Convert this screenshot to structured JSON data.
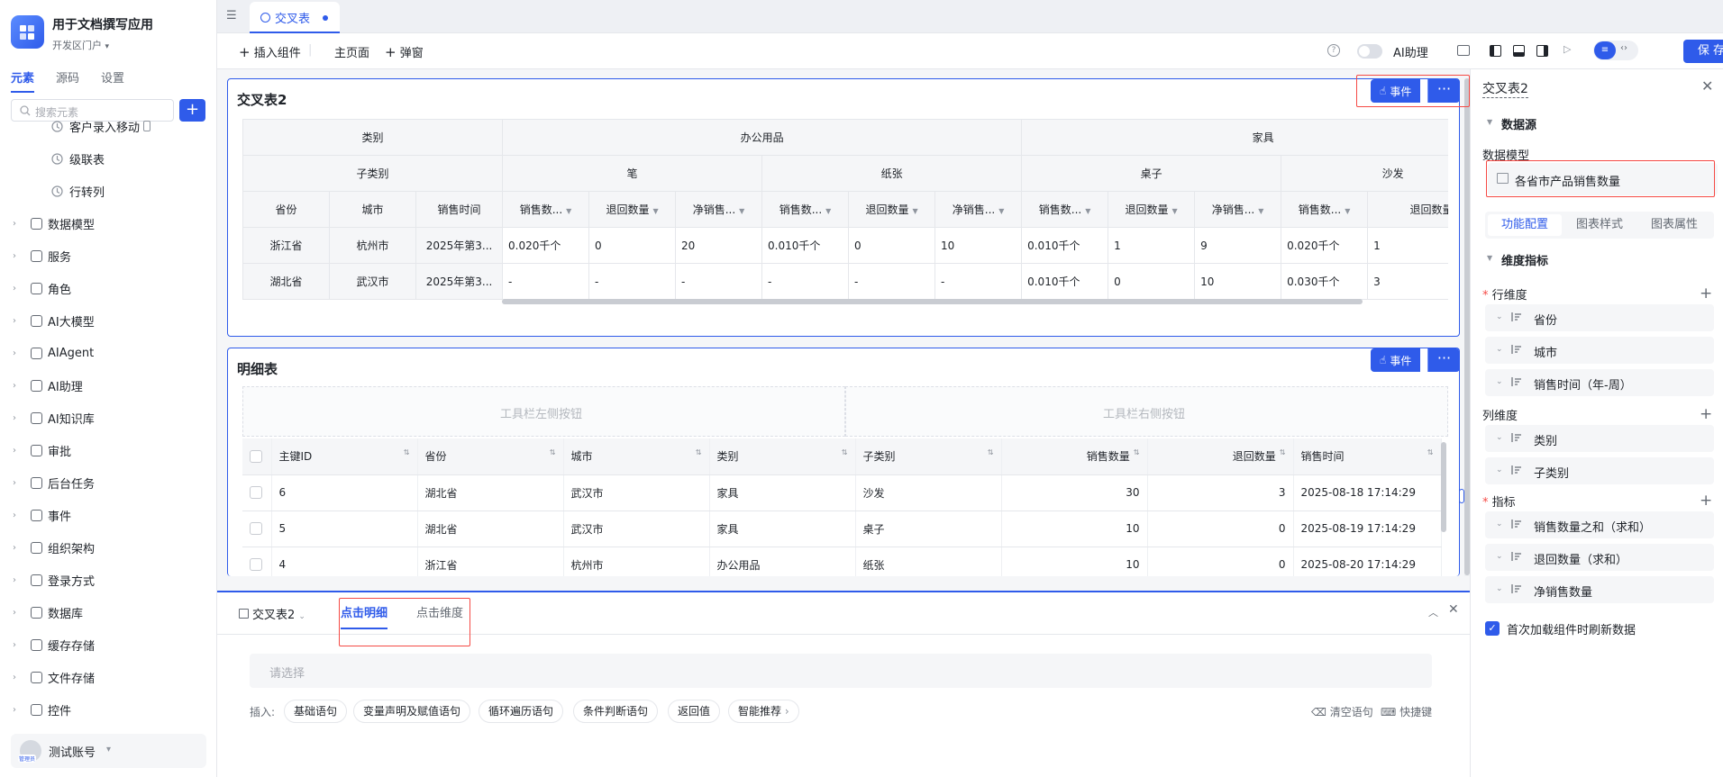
{
  "app": {
    "name": "用于文档撰写应用",
    "portal": "开发区门户"
  },
  "left_tabs": [
    "元素",
    "源码",
    "设置"
  ],
  "search": {
    "placeholder": "搜索元素"
  },
  "tree": {
    "children": [
      {
        "label": "客户录入移动"
      },
      {
        "label": "级联表"
      },
      {
        "label": "行转列"
      }
    ],
    "groups": [
      {
        "label": "数据模型",
        "icon": "table-icon"
      },
      {
        "label": "服务",
        "icon": "service-icon"
      },
      {
        "label": "角色",
        "icon": "role-icon"
      },
      {
        "label": "AI大模型",
        "icon": "ai-model-icon"
      },
      {
        "label": "AIAgent",
        "icon": "robot-icon"
      },
      {
        "label": "AI助理",
        "icon": "ai-assistant-icon"
      },
      {
        "label": "AI知识库",
        "icon": "knowledge-icon"
      },
      {
        "label": "审批",
        "icon": "approval-icon"
      },
      {
        "label": "后台任务",
        "icon": "task-icon"
      },
      {
        "label": "事件",
        "icon": "event-icon"
      },
      {
        "label": "组织架构",
        "icon": "org-icon"
      },
      {
        "label": "登录方式",
        "icon": "login-icon"
      },
      {
        "label": "数据库",
        "icon": "database-icon"
      },
      {
        "label": "缓存存储",
        "icon": "cache-icon"
      },
      {
        "label": "文件存储",
        "icon": "file-icon"
      },
      {
        "label": "控件",
        "icon": "widget-icon"
      }
    ]
  },
  "account": {
    "name": "测试账号",
    "badge": "管理员"
  },
  "doc_tab": {
    "label": "交叉表"
  },
  "toolbar": {
    "insert": "插入组件",
    "main_page": "主页面",
    "popup": "弹窗",
    "ai_assistant": "AI助理",
    "save": "保 存"
  },
  "cross_table": {
    "title": "交叉表2",
    "event_label": "事件",
    "headers": {
      "category_label": "类别",
      "subcategory_label": "子类别",
      "row_labels": [
        "省份",
        "城市",
        "销售时间"
      ],
      "categories": [
        "办公用品",
        "家具"
      ],
      "subcategories": [
        "笔",
        "纸张",
        "桌子",
        "沙发"
      ],
      "measures": [
        "销售数...",
        "退回数量",
        "净销售...",
        "销售数...",
        "退回数量",
        "净销售...",
        "销售数...",
        "退回数量",
        "净销售...",
        "销售数...",
        "退回数量"
      ]
    },
    "rows": [
      {
        "cells": [
          "浙江省",
          "杭州市",
          "2025年第3...",
          "0.020千个",
          "0",
          "20",
          "0.010千个",
          "0",
          "10",
          "0.010千个",
          "1",
          "9",
          "0.020千个",
          "1"
        ]
      },
      {
        "cells": [
          "湖北省",
          "武汉市",
          "2025年第3...",
          "-",
          "-",
          "-",
          "-",
          "-",
          "-",
          "0.010千个",
          "0",
          "10",
          "0.030千个",
          "3"
        ]
      }
    ]
  },
  "detail_table": {
    "title": "明细表",
    "event_label": "事件",
    "toolbar_left": "工具栏左侧按钮",
    "toolbar_right": "工具栏右侧按钮",
    "columns": [
      "主键ID",
      "省份",
      "城市",
      "类别",
      "子类别",
      "销售数量",
      "退回数量",
      "销售时间"
    ],
    "rows": [
      {
        "cells": [
          "6",
          "湖北省",
          "武汉市",
          "家具",
          "沙发",
          "30",
          "3",
          "2025-08-18 17:14:29"
        ]
      },
      {
        "cells": [
          "5",
          "湖北省",
          "武汉市",
          "家具",
          "桌子",
          "10",
          "0",
          "2025-08-19 17:14:29"
        ]
      },
      {
        "cells": [
          "4",
          "浙江省",
          "杭州市",
          "办公用品",
          "纸张",
          "10",
          "0",
          "2025-08-20 17:14:29"
        ]
      }
    ]
  },
  "bottom": {
    "component": "交叉表2",
    "tabs": [
      "点击明细",
      "点击维度"
    ],
    "select_placeholder": "请选择",
    "insert_label": "插入:",
    "chips": [
      "基础语句",
      "变量声明及赋值语句",
      "循环遍历语句",
      "条件判断语句",
      "返回值",
      "智能推荐"
    ],
    "clear": "清空语句",
    "shortcut": "快捷键"
  },
  "right_panel": {
    "title": "交叉表2",
    "datasource_label": "数据源",
    "model_label": "数据模型",
    "model_value": "各省市产品销售数量",
    "tabs": [
      "功能配置",
      "图表样式",
      "图表属性"
    ],
    "dim_section": "维度指标",
    "row_dim_label": "行维度",
    "row_dims": [
      "省份",
      "城市",
      "销售时间（年-周）"
    ],
    "col_dim_label": "列维度",
    "col_dims": [
      "类别",
      "子类别"
    ],
    "metric_label": "指标",
    "metrics": [
      "销售数量之和（求和）",
      "退回数量（求和）",
      "净销售数量"
    ],
    "refresh_label": "首次加载组件时刷新数据"
  },
  "colors": {
    "accent": "#2f5bea",
    "highlight": "#f54a45"
  }
}
